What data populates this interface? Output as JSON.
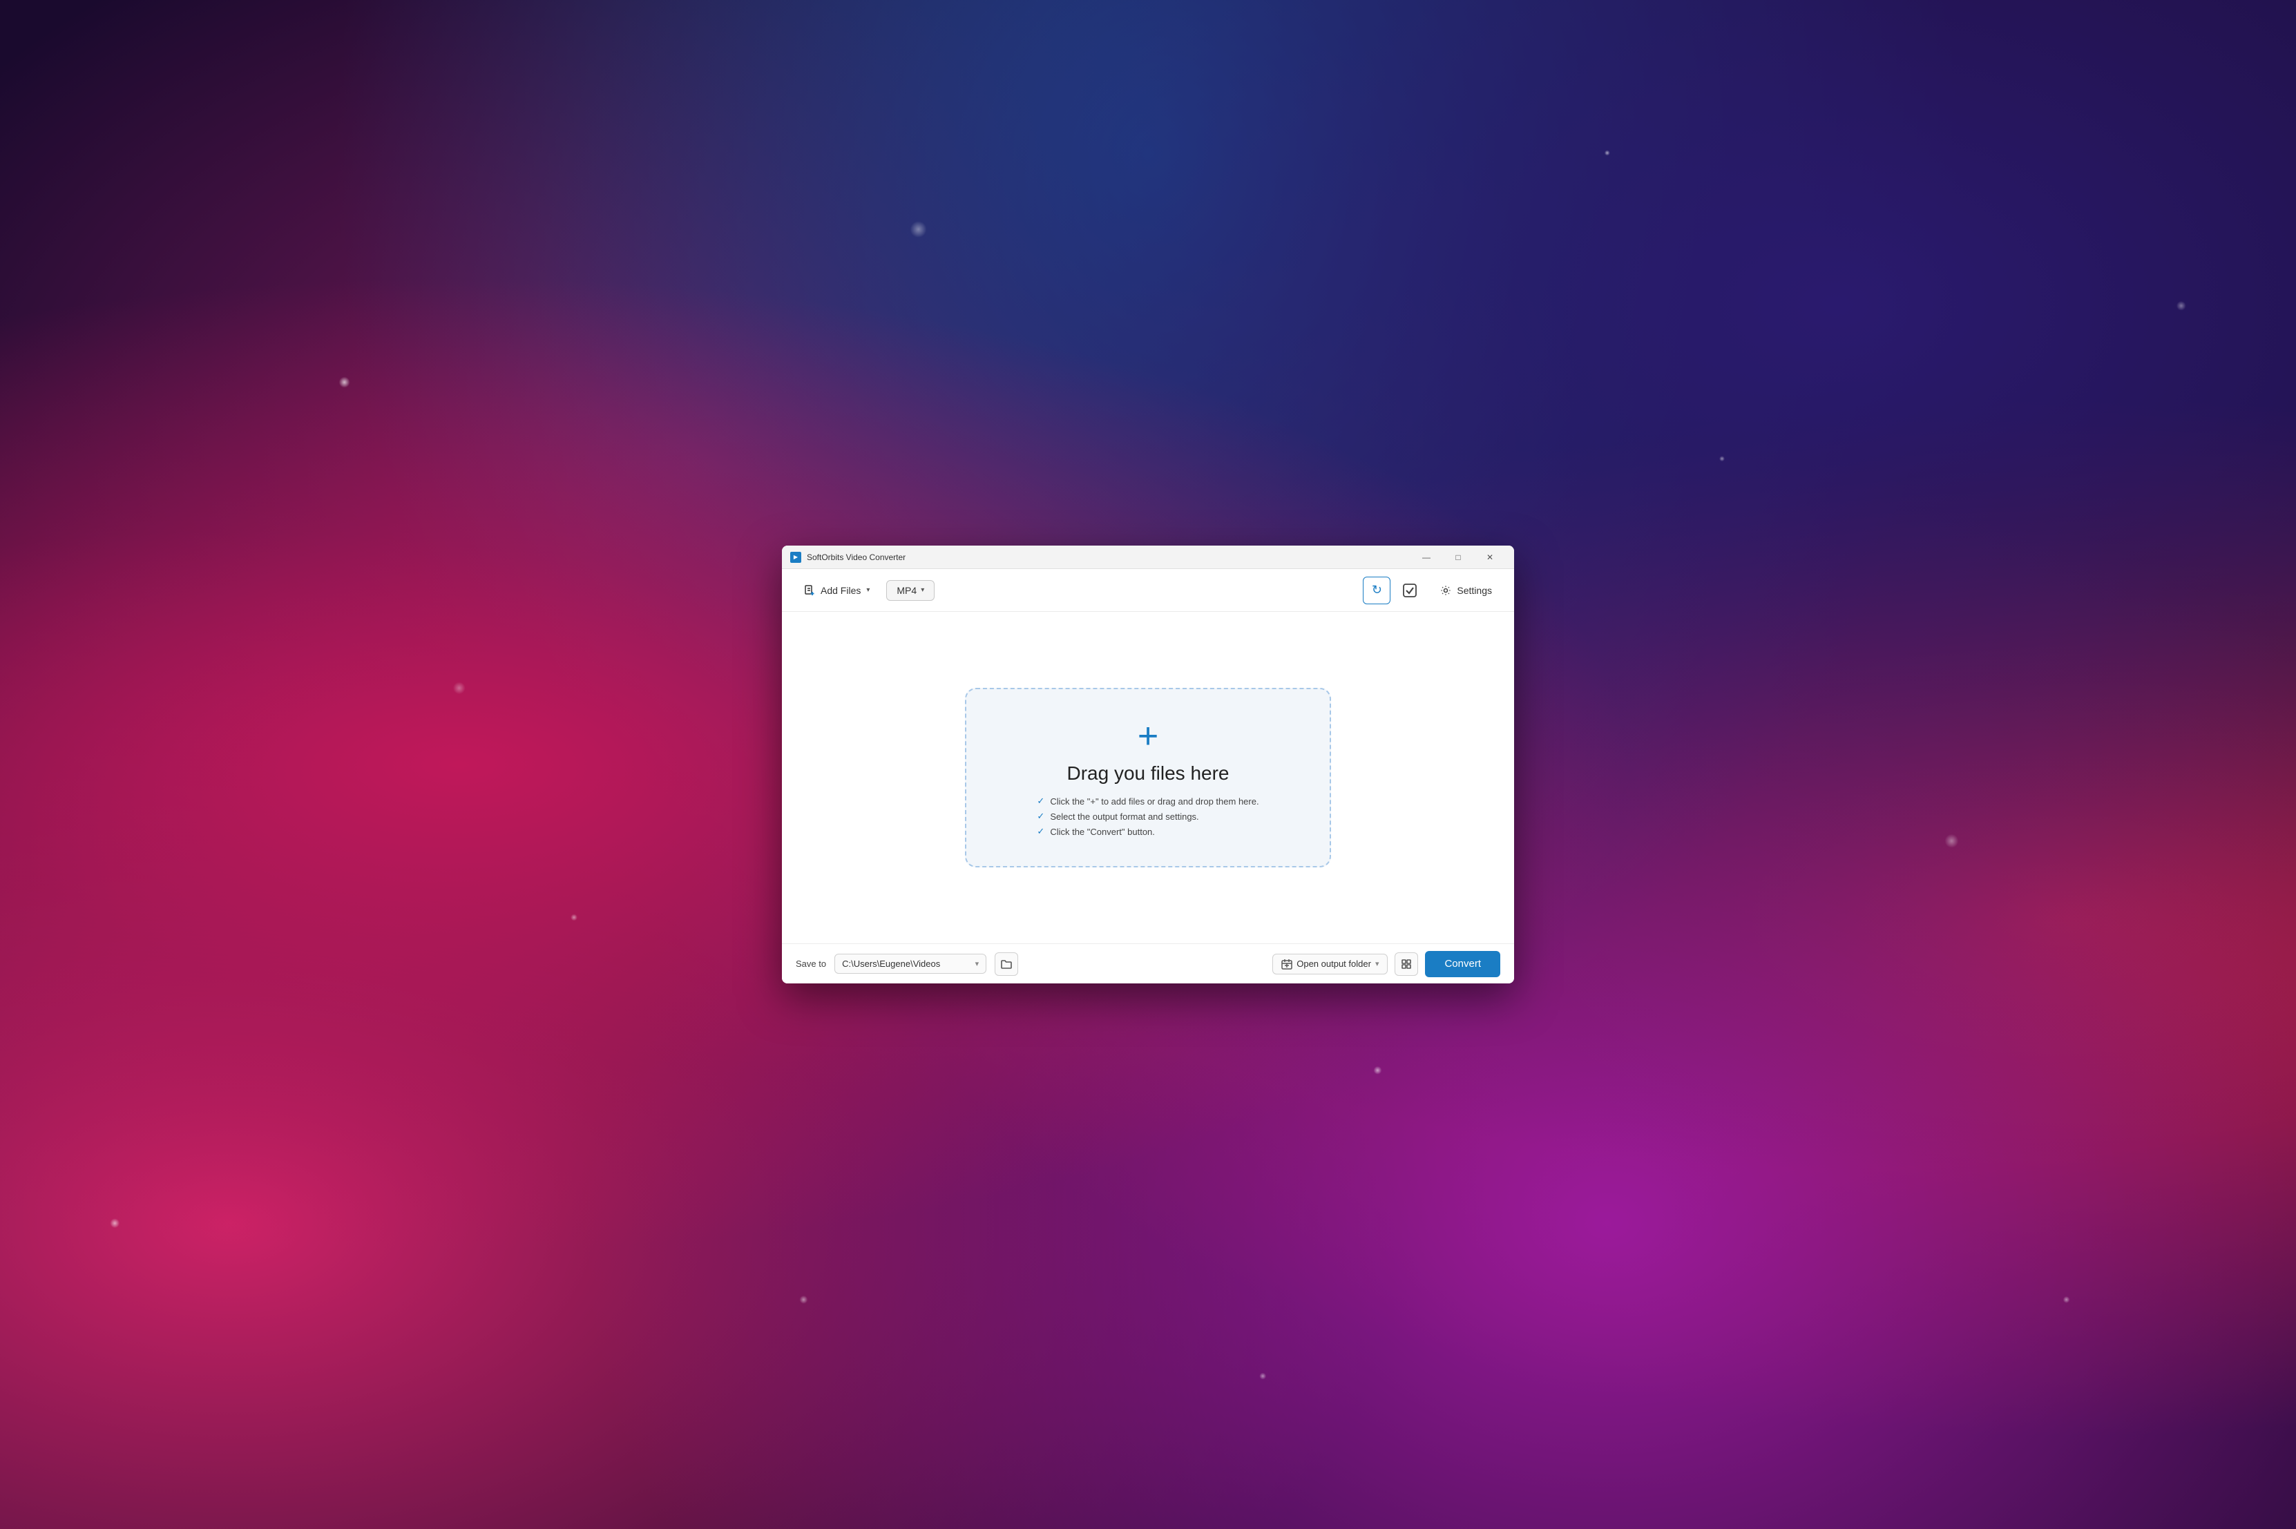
{
  "window": {
    "title": "SoftOrbits Video Converter",
    "min_label": "—",
    "max_label": "□",
    "close_label": "✕"
  },
  "toolbar": {
    "add_files_label": "Add Files",
    "format_label": "MP4",
    "refresh_label": "↻",
    "check_label": "✔",
    "settings_label": "Settings"
  },
  "drop_zone": {
    "title": "Drag you files here",
    "instructions": [
      "Click the \"+\" to add files or drag and drop them here.",
      "Select the output format and settings.",
      "Click the \"Convert\" button."
    ]
  },
  "footer": {
    "save_to_label": "Save to",
    "save_path": "C:\\Users\\Eugene\\Videos",
    "open_output_label": "Open output folder",
    "convert_label": "Convert"
  }
}
